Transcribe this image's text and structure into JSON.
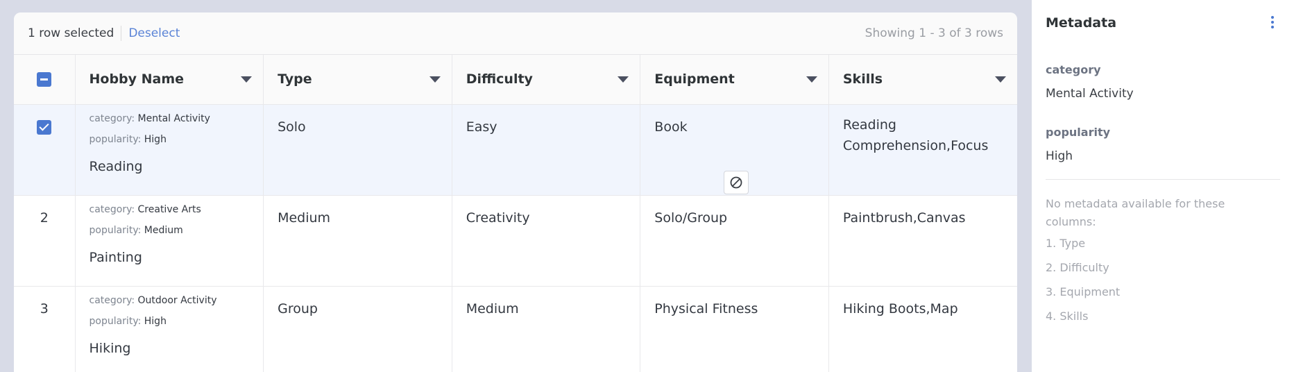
{
  "toolbar": {
    "selection_text": "1 row selected",
    "deselect_label": "Deselect",
    "showing_text": "Showing 1 - 3 of 3 rows"
  },
  "table": {
    "columns": [
      "Hobby Name",
      "Type",
      "Difficulty",
      "Equipment",
      "Skills"
    ],
    "meta_keys": [
      "category",
      "popularity"
    ],
    "rows": [
      {
        "number": "",
        "selected": true,
        "category": "Mental Activity",
        "popularity": "High",
        "name": "Reading",
        "type": "Solo",
        "difficulty": "Easy",
        "equipment": "Book",
        "skills": "Reading Comprehension,Focus"
      },
      {
        "number": "2",
        "selected": false,
        "category": "Creative Arts",
        "popularity": "Medium",
        "name": "Painting",
        "type": "Medium",
        "difficulty": "Creativity",
        "equipment": "Solo/Group",
        "skills": "Paintbrush,Canvas"
      },
      {
        "number": "3",
        "selected": false,
        "category": "Outdoor Activity",
        "popularity": "High",
        "name": "Hiking",
        "type": "Group",
        "difficulty": "Medium",
        "equipment": "Physical Fitness",
        "skills": "Hiking Boots,Map"
      }
    ]
  },
  "panel": {
    "title": "Metadata",
    "fields": [
      {
        "key": "category",
        "value": "Mental Activity"
      },
      {
        "key": "popularity",
        "value": "High"
      }
    ],
    "note": "No metadata available for these columns:",
    "missing_columns": [
      "1. Type",
      "2. Difficulty",
      "3. Equipment",
      "4. Skills"
    ]
  },
  "colors": {
    "accent": "#4a78d0",
    "link": "#5a83d6",
    "selected_row": "#f1f5fd",
    "background": "#d8dbe7"
  }
}
